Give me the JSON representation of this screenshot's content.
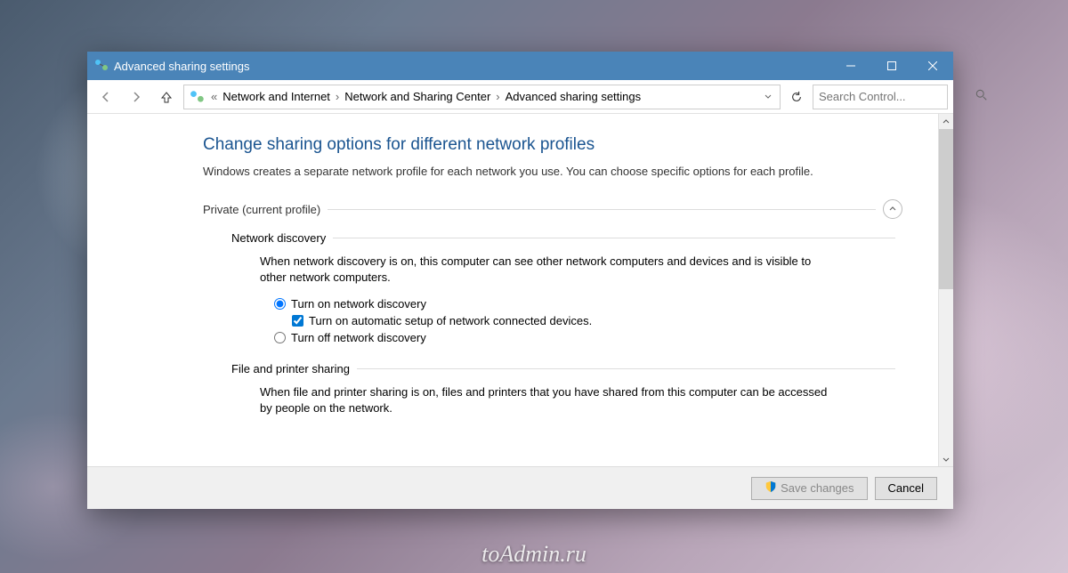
{
  "window": {
    "title": "Advanced sharing settings"
  },
  "breadcrumb": {
    "prefix": "«",
    "items": [
      "Network and Internet",
      "Network and Sharing Center",
      "Advanced sharing settings"
    ]
  },
  "search": {
    "placeholder": "Search Control..."
  },
  "page": {
    "title": "Change sharing options for different network profiles",
    "description": "Windows creates a separate network profile for each network you use. You can choose specific options for each profile."
  },
  "section_private": {
    "label": "Private (current profile)"
  },
  "network_discovery": {
    "title": "Network discovery",
    "description": "When network discovery is on, this computer can see other network computers and devices and is visible to other network computers.",
    "option_on": "Turn on network discovery",
    "checkbox_auto": "Turn on automatic setup of network connected devices.",
    "option_off": "Turn off network discovery"
  },
  "file_printer": {
    "title": "File and printer sharing",
    "description": "When file and printer sharing is on, files and printers that you have shared from this computer can be accessed by people on the network."
  },
  "buttons": {
    "save": "Save changes",
    "cancel": "Cancel"
  },
  "watermark": "toAdmin.ru"
}
